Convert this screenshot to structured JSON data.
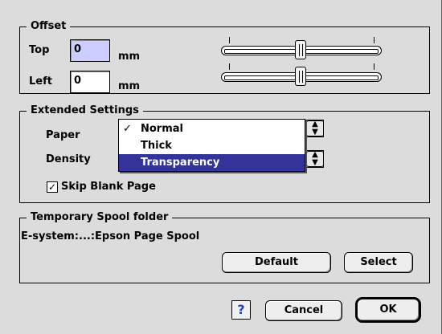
{
  "offset": {
    "title": "Offset",
    "top_label": "Top",
    "top_value": "0",
    "left_label": "Left",
    "left_value": "0",
    "unit": "mm"
  },
  "extended": {
    "title": "Extended Settings",
    "paper_label": "Paper",
    "density_label": "Density",
    "paper_options": [
      "Normal",
      "Thick",
      "Transparency"
    ],
    "paper_checked": "✓",
    "skip_blank_label": "Skip Blank Page",
    "skip_blank_checked": true
  },
  "spool": {
    "title": "Temporary Spool folder",
    "path": "E-system:...:Epson Page Spool",
    "default_label": "Default",
    "select_label": "Select"
  },
  "footer": {
    "help_label": "?",
    "cancel_label": "Cancel",
    "ok_label": "OK"
  },
  "icons": {
    "popup_arrows": "updown-arrows-icon",
    "checkmark": "checkmark-icon",
    "help": "help-icon"
  }
}
